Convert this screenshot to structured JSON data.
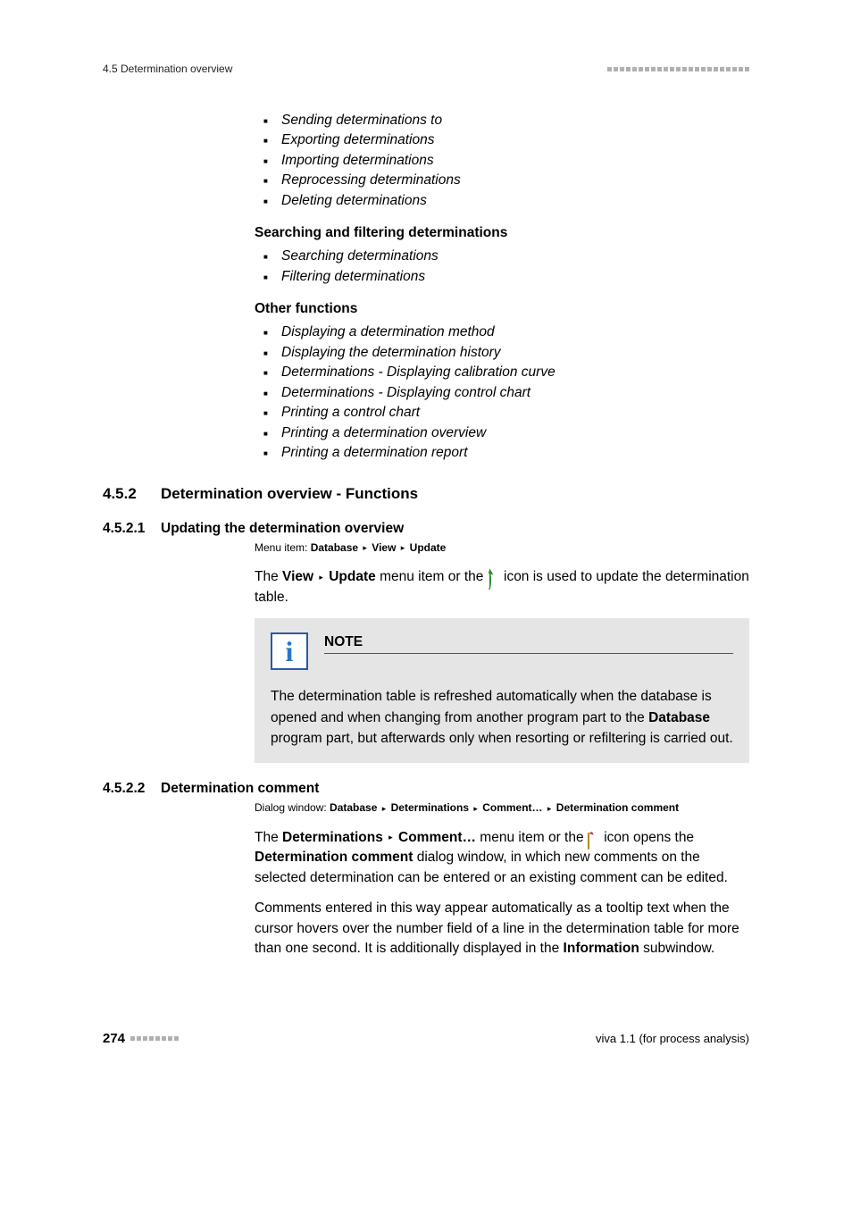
{
  "header": {
    "section_label": "4.5 Determination overview"
  },
  "lists": {
    "top": [
      "Sending determinations to",
      "Exporting determinations",
      "Importing determinations",
      "Reprocessing determinations",
      "Deleting determinations"
    ],
    "search_heading": "Searching and filtering determinations",
    "search": [
      "Searching determinations",
      "Filtering determinations"
    ],
    "other_heading": "Other functions",
    "other": [
      "Displaying a determination method",
      "Displaying the determination history",
      "Determinations - Displaying calibration curve",
      "Determinations - Displaying control chart",
      "Printing a control chart",
      "Printing a determination overview",
      "Printing a determination report"
    ]
  },
  "section452": {
    "num": "4.5.2",
    "title": "Determination overview - Functions"
  },
  "section4521": {
    "num": "4.5.2.1",
    "title": "Updating the determination overview",
    "menu_prefix": "Menu item: ",
    "menu_path": [
      "Database",
      "View",
      "Update"
    ],
    "para_pre": "The ",
    "para_bold1": "View",
    "para_bold2": "Update",
    "para_mid": " menu item or the ",
    "para_post": " icon is used to update the determination table."
  },
  "note": {
    "title": "NOTE",
    "body_pre": "The determination table is refreshed automatically when the database is opened and when changing from another program part to the ",
    "body_bold": "Database",
    "body_post": " program part, but afterwards only when resorting or refiltering is carried out."
  },
  "section4522": {
    "num": "4.5.2.2",
    "title": "Determination comment",
    "dlg_prefix": "Dialog window: ",
    "dlg_path": [
      "Database",
      "Determinations",
      "Comment…",
      "Determination comment"
    ],
    "p1_pre": "The ",
    "p1_b1": "Determinations",
    "p1_b2": "Comment…",
    "p1_mid": " menu item or the ",
    "p1_post1": " icon opens the ",
    "p1_b3": "Determination comment",
    "p1_post2": " dialog window, in which new comments on the selected determination can be entered or an existing comment can be edited.",
    "p2_pre": "Comments entered in this way appear automatically as a tooltip text when the cursor hovers over the number field of a line in the determination table for more than one second. It is additionally displayed in the ",
    "p2_b": "Information",
    "p2_post": " subwindow."
  },
  "footer": {
    "page": "274",
    "product": "viva 1.1 (for process analysis)"
  }
}
